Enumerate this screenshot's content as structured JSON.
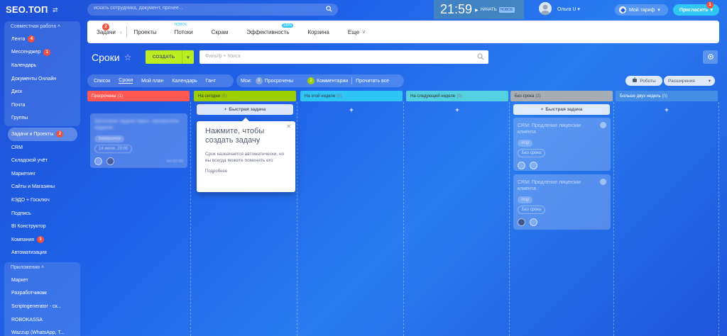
{
  "topbar": {
    "logo": "SEO.ТОП",
    "search_placeholder": "искать сотрудника, документ, прочее...",
    "clock": "21:59",
    "start_label": "НАЧАТЬ",
    "new_badge": "НОВОЕ",
    "user_name": "Ольга U",
    "tariff_label": "Мой тариф",
    "invite_label": "Пригласить",
    "invite_counter": "1"
  },
  "sidebar": {
    "group1_title": "Совместная работа",
    "items": [
      {
        "label": "Лента",
        "counter": "4"
      },
      {
        "label": "Мессенджер",
        "counter": "1"
      },
      {
        "label": "Календарь",
        "counter": ""
      },
      {
        "label": "Документы Онлайн",
        "counter": ""
      },
      {
        "label": "Диск",
        "counter": ""
      },
      {
        "label": "Почта",
        "counter": ""
      },
      {
        "label": "Группы",
        "counter": ""
      }
    ],
    "active_item": {
      "label": "Задачи и Проекты",
      "counter": "2"
    },
    "items2": [
      {
        "label": "CRM",
        "counter": ""
      },
      {
        "label": "Складской учёт",
        "counter": ""
      },
      {
        "label": "Маркетинг",
        "counter": ""
      },
      {
        "label": "Сайты и Магазины",
        "counter": ""
      },
      {
        "label": "КЭДО + Госключ",
        "counter": ""
      },
      {
        "label": "Подпись",
        "counter": ""
      },
      {
        "label": "BI Конструктор",
        "counter": ""
      },
      {
        "label": "Компания",
        "counter": "1"
      },
      {
        "label": "Автоматизация",
        "counter": ""
      }
    ],
    "group2_title": "Приложения",
    "apps": [
      "Маркет",
      "Разработчикам",
      "Scriptogenerator - ск...",
      "ROBOKASSA",
      "Wazzup (WhatsApp, T..."
    ]
  },
  "tabs": {
    "tasks": "Задачи",
    "tasks_counter": "2",
    "projects": "Проекты",
    "flows": "Потоки",
    "flows_new": "НОВОЕ",
    "scrum": "Скрам",
    "efficiency": "Эффективность",
    "efficiency_pct": "100%",
    "trash": "Корзина",
    "more": "Еще"
  },
  "toolbar": {
    "title": "Сроки",
    "create_label": "СОЗДАТЬ",
    "filter_placeholder": "Фильтр + поиск"
  },
  "views": {
    "list": "Список",
    "deadlines": "Сроки",
    "my_plan": "Мой план",
    "calendar": "Календарь",
    "gantt": "Гант"
  },
  "mine": {
    "label": "Мои:",
    "overdue_count": "0",
    "overdue": "Просрочены",
    "comments_count": "2",
    "comments": "Комментарии",
    "read_all": "Прочитать все",
    "robots": "Роботы",
    "extensions": "Расширения"
  },
  "columns": [
    {
      "title": "Просрочены",
      "count": "(1)",
      "color": "#ff5752"
    },
    {
      "title": "На сегодня",
      "count": "(0)",
      "color": "#9dcf00"
    },
    {
      "title": "На этой неделе",
      "count": "(0)",
      "color": "#2fc6f6"
    },
    {
      "title": "На следующей неделе",
      "count": "(0)",
      "color": "#55d0e0"
    },
    {
      "title": "Без срока",
      "count": "(2)",
      "color": "#a8adb4"
    },
    {
      "title": "Больше двух недель",
      "count": "(0)",
      "color": "#468ee5"
    }
  ],
  "quick_task": "Быстрая задача",
  "cards": {
    "overdue_card": {
      "title": "Заголовок задачи скрыт, просрочено задание",
      "tag": "Завершена",
      "date": "14 июля, 23:00",
      "time": "00:00:00"
    },
    "crm1": {
      "title": "CRM: Продление лицензии клиента",
      "tag": "#ctp",
      "status": "Без срока"
    },
    "crm2": {
      "title": "CRM: Продление лицензии клиента",
      "tag": "#ctp",
      "status": "Без срока"
    }
  },
  "popup": {
    "title": "Нажмите, чтобы создать задачу",
    "text": "Срок назначается автоматически, но вы всегда можете поменять его",
    "more": "Подробнее"
  }
}
